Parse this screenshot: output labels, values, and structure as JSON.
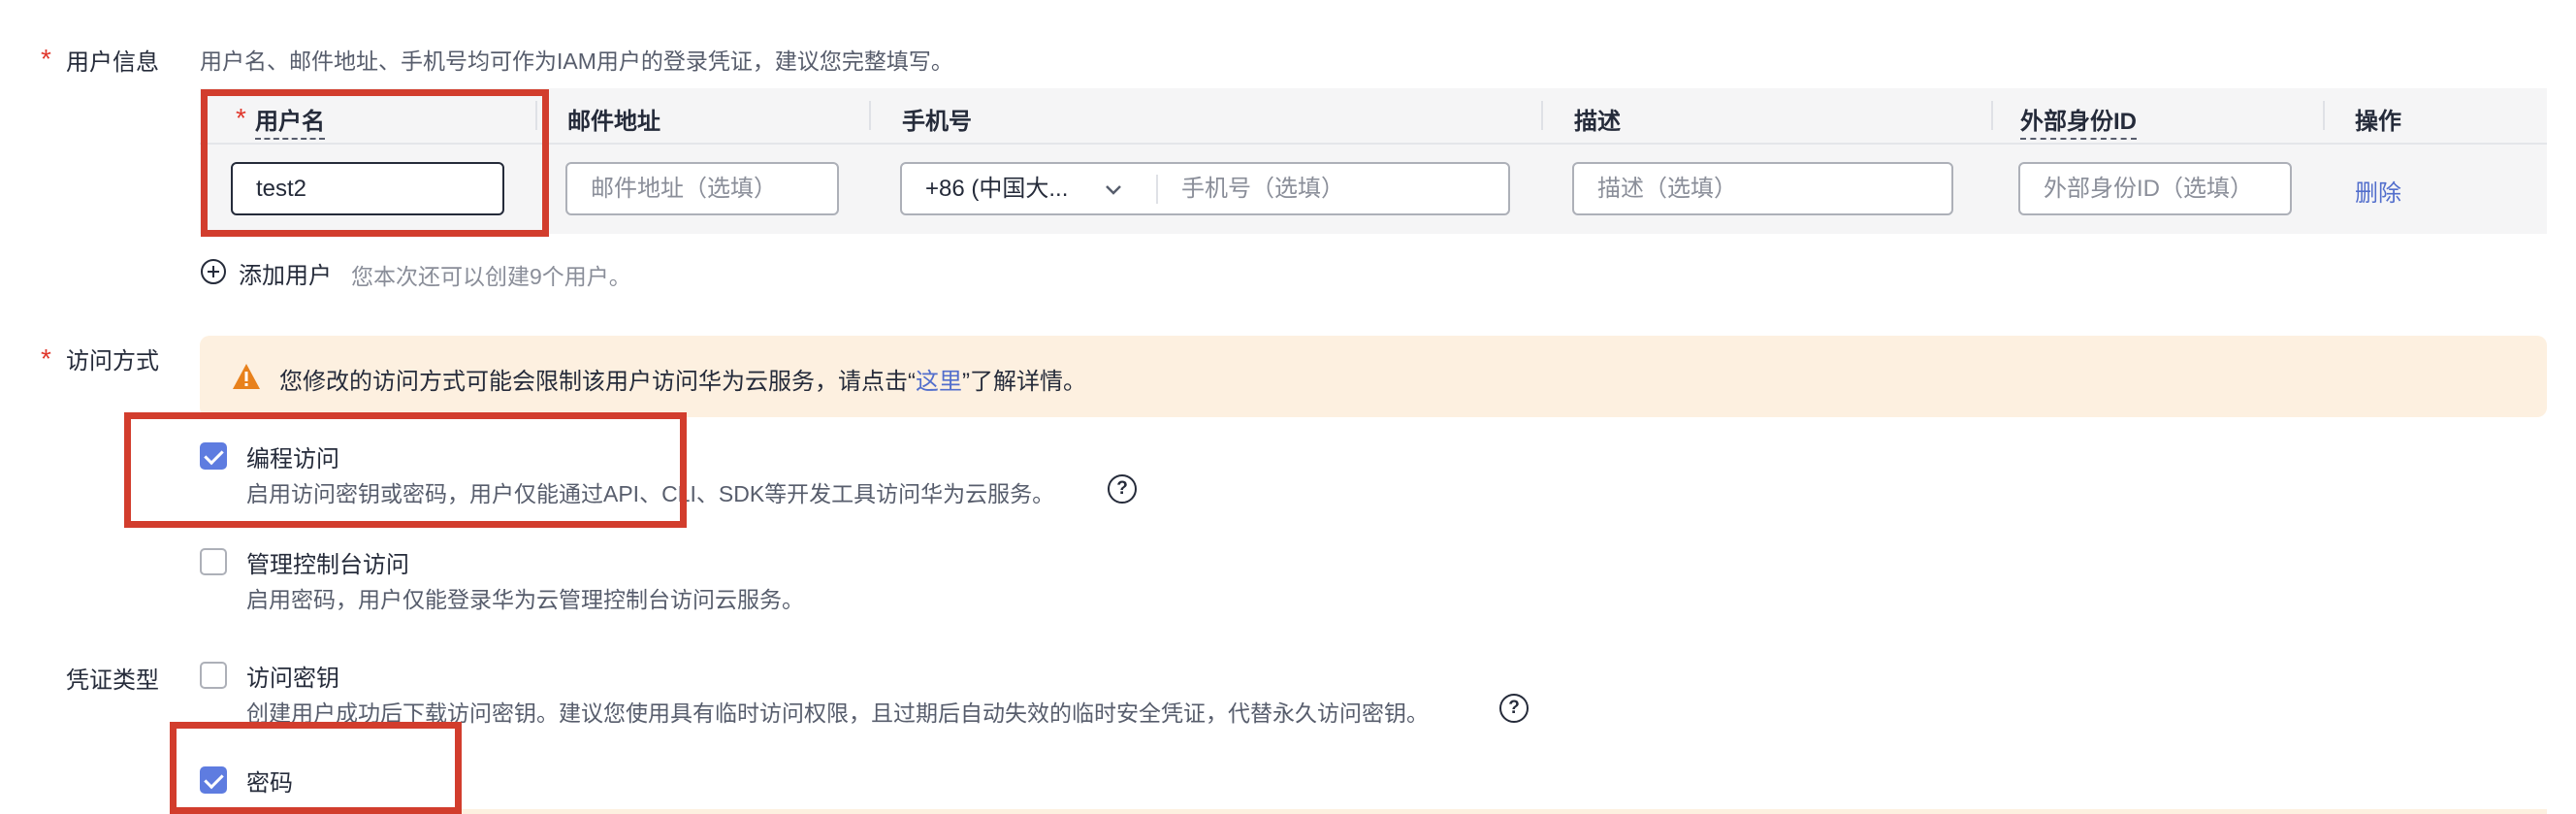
{
  "user_info": {
    "label": "用户信息",
    "hint": "用户名、邮件地址、手机号均可作为IAM用户的登录凭证，建议您完整填写。",
    "columns": {
      "username": "用户名",
      "email": "邮件地址",
      "phone": "手机号",
      "description": "描述",
      "external_id": "外部身份ID",
      "action": "操作"
    },
    "row": {
      "username_value": "test2",
      "email_placeholder": "邮件地址（选填）",
      "country_code": "+86 (中国大...",
      "phone_placeholder": "手机号（选填）",
      "description_placeholder": "描述（选填）",
      "external_id_placeholder": "外部身份ID（选填）",
      "delete_label": "删除"
    },
    "add_user_label": "添加用户",
    "add_user_hint": "您本次还可以创建9个用户。"
  },
  "access": {
    "label": "访问方式",
    "warning_prefix": "您修改的访问方式可能会限制该用户访问华为云服务，请点击“",
    "warning_link": "这里",
    "warning_suffix": "”了解详情。",
    "programmatic": {
      "label": "编程访问",
      "desc": "启用访问密钥或密码，用户仅能通过API、CLI、SDK等开发工具访问华为云服务。",
      "checked": true
    },
    "console": {
      "label": "管理控制台访问",
      "desc": "启用密码，用户仅能登录华为云管理控制台访问云服务。",
      "checked": false
    }
  },
  "credential": {
    "label": "凭证类型",
    "access_key": {
      "label": "访问密钥",
      "desc": "创建用户成功后下载访问密钥。建议您使用具有临时访问权限，且过期后自动失效的临时安全凭证，代替永久访问密钥。",
      "checked": false
    },
    "password": {
      "label": "密码",
      "checked": true
    }
  },
  "colors": {
    "accent": "#5e7ce0",
    "warning_bg": "#fdf0e0",
    "warning_icon": "#e8811c",
    "required": "#e0372c",
    "highlight_box": "#d23d2d"
  }
}
